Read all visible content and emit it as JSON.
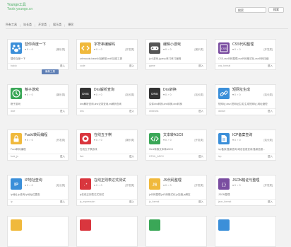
{
  "app": {
    "logo_line1": "Youngo工具",
    "logo_line2": "Tools youngo.cn"
  },
  "search": {
    "placeholder": "搜索",
    "button": "搜索"
  },
  "nav": [
    "所有工具",
    "站长类",
    "开发类",
    "娱乐类",
    "便民"
  ],
  "cards": [
    {
      "title": "替你百度一下",
      "meta": "♥ 0 ♂ 0",
      "tag": "[娱乐类]",
      "desc": "替你百度一下",
      "slug": "baidu",
      "enter": "进入",
      "icon": "paw-icon",
      "color": "#3b8fd9"
    },
    {
      "title": "字符串编解码",
      "meta": "♥ 0 ♂ 0",
      "tag": "[开发类]",
      "desc": "urlencode,base64加解密,md5加密工具",
      "slug": "code",
      "enter": "进入",
      "icon": "code-icon",
      "color": "#f0b93c"
    },
    {
      "title": "编辑小游戏",
      "meta": "♥ 0 ♂ 0",
      "tag": "[娱乐类]",
      "desc": "js小游戏,jquery,练习练习编程",
      "slug": "game",
      "enter": "进入",
      "icon": "gamepad-icon",
      "color": "#555555"
    },
    {
      "title": "CSS代码整理",
      "meta": "♥ 0 ♂ 0",
      "tag": "[开发类]",
      "desc": "CSS,css代码整理,css代码格式化,css代码压缩",
      "slug": "css_format",
      "enter": "进入",
      "icon": "css-icon",
      "color": "#7a4da0"
    },
    {
      "title": "粮子游戏",
      "meta": "♥ 0 ♂ 0",
      "tag": "[娱乐类]",
      "desc": "粮子游戏",
      "slug": "dice",
      "enter": "进入",
      "icon": "clock-icon",
      "color": "#3aa757"
    },
    {
      "title": "Dns解析查询",
      "meta": "♥ 0 ♂ 0",
      "tag": "[站长类]",
      "desc": "dns解析查询,dns记录查询,ns解析查询",
      "slug": "dns",
      "enter": "进入",
      "icon": "dns-icon",
      "color": "#333333"
    },
    {
      "title": "Dns转换",
      "meta": "♥ 0 ♂ 0",
      "tag": "[站长类]",
      "desc": "实体dns转换,dns转换,dns转换",
      "slug": "dnstrans",
      "enter": "进入",
      "icon": "dns-icon",
      "color": "#333333"
    },
    {
      "title": "短网址生成",
      "meta": "♥ 0 ♂ 0",
      "tag": "[站长类]",
      "desc": "短网址,dwz,短网址生成,生成短网址,网址缩短",
      "slug": "dwzurl",
      "enter": "进入",
      "icon": "link-icon",
      "color": "#3b8fd9"
    },
    {
      "title": "Fuck/转码编程",
      "meta": "♥ 0 ♂ 0",
      "tag": "[开发类]",
      "desc": "Fuck转码编程",
      "slug": "fuck_js",
      "enter": "进入",
      "icon": "lock-icon",
      "color": "#f0b93c"
    },
    {
      "title": "在线五子棋",
      "meta": "♥ 0 ♂ 0",
      "tag": "[娱乐类]",
      "desc": "在线五子棋游戏",
      "slug": "five",
      "enter": "进入",
      "icon": "circle-icon",
      "color": "#d9363e"
    },
    {
      "title": "文本转ASCII",
      "meta": "♥ 0 ♂ 0",
      "tag": "[开发类]",
      "desc": "Html转换文本转ASCII",
      "slug": "HTML_ASCII",
      "enter": "进入",
      "icon": "html-icon",
      "color": "#3aa757"
    },
    {
      "title": "ICP备案查询",
      "meta": "♥ 0 ♂ 0",
      "tag": "[站长类]",
      "desc": "icp备案,备案查询,域名信息查询,备案信息...",
      "slug": "icp",
      "enter": "进入",
      "icon": "file-icon",
      "color": "#3b8fd9"
    },
    {
      "title": "IP地址查询",
      "meta": "♥ 0 ♂ 0",
      "tag": "[站长类]",
      "desc": "ip地址,ip查询,ip地址位置查",
      "slug": "ip",
      "enter": "进入",
      "icon": "ip-icon",
      "color": "#3b8fd9"
    },
    {
      "title": "在线正则表达式测试",
      "meta": "♥ 0 ♂ 0",
      "tag": "[开发类]",
      "desc": "js在线正则表达式测试",
      "slug": "js_expression",
      "enter": "进入",
      "icon": "regex-icon",
      "color": "#d9363e"
    },
    {
      "title": "JS代码整理",
      "meta": "♥ 0 ♂ 0",
      "tag": "[开发类]",
      "desc": "js代码整理,js代码格式化,js压缩,js解压",
      "slug": "js_format",
      "enter": "进入",
      "icon": "js-icon",
      "color": "#f0b93c"
    },
    {
      "title": "JSON格证与整理",
      "meta": "♥ 0 ♂ 0",
      "tag": "[开发类]",
      "desc": "JSON整理",
      "slug": "json_format",
      "enter": "进入",
      "icon": "json-icon",
      "color": "#7a4da0"
    }
  ],
  "bottom_row_colors": [
    "#f0b93c",
    "#d9363e",
    "#3aa757",
    "#3b8fd9"
  ],
  "tooltip": "最新工具"
}
